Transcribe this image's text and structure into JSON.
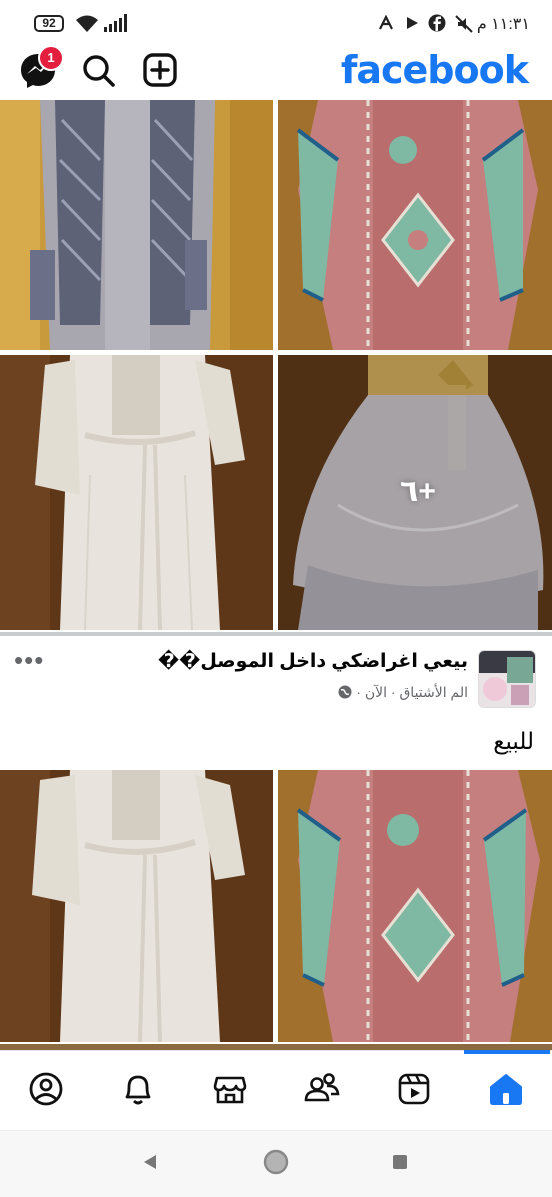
{
  "status_bar": {
    "battery": "92",
    "time": "١١:٣١ م"
  },
  "header": {
    "logo": "facebook",
    "messenger_badge": "1"
  },
  "gallery_top": {
    "more_count": "٦+"
  },
  "post": {
    "author": "بيعي اغراضكي داخل الموصل��",
    "meta": "الم الأشتياق · الآن ·",
    "text": "للبيع"
  },
  "nav": {
    "items": [
      "profile",
      "notifications",
      "marketplace",
      "groups",
      "watch",
      "home"
    ],
    "active": "home"
  },
  "colors": {
    "brand": "#1877f2",
    "badge": "#e41e3f"
  }
}
